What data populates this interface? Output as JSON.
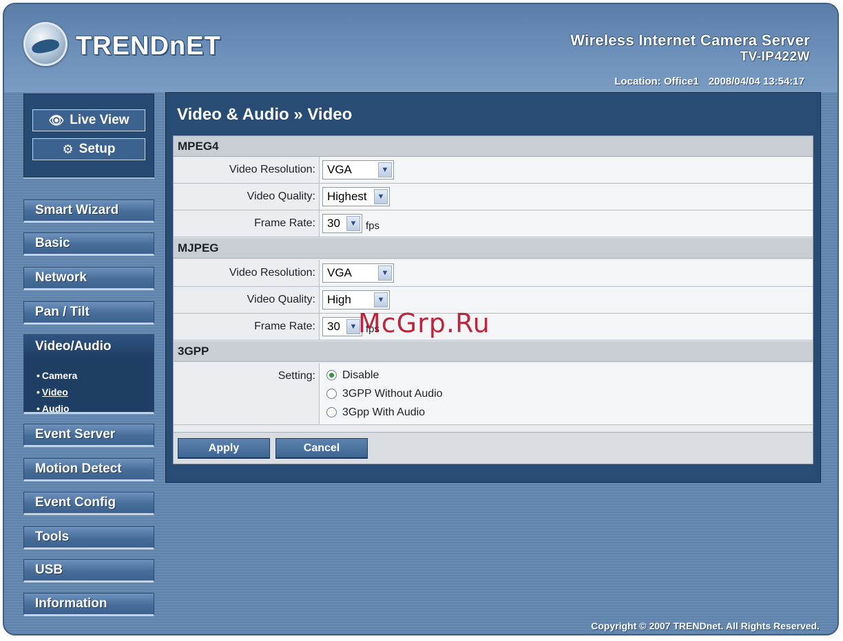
{
  "brand": {
    "logo_text": "TRENDnET"
  },
  "product": {
    "name": "Wireless Internet Camera Server",
    "model": "TV-IP422W"
  },
  "location": {
    "label": "Location: Office1",
    "datetime": "2008/04/04 13:54:17"
  },
  "view_buttons": {
    "live_view": "Live View",
    "setup": "Setup"
  },
  "menu": {
    "items": [
      "Smart Wizard",
      "Basic",
      "Network",
      "Pan / Tilt",
      "Video/Audio",
      "Event Server",
      "Motion Detect",
      "Event Config",
      "Tools",
      "USB",
      "Information"
    ],
    "active": "Video/Audio",
    "submenu": [
      "Camera",
      "Video",
      "Audio"
    ],
    "current_sub": "Video"
  },
  "panel": {
    "title": "Video & Audio » Video",
    "mpeg4": {
      "heading": "MPEG4",
      "resolution_label": "Video Resolution:",
      "resolution_value": "VGA",
      "quality_label": "Video Quality:",
      "quality_value": "Highest",
      "framerate_label": "Frame Rate:",
      "framerate_value": "30",
      "framerate_unit": "fps"
    },
    "mjpeg": {
      "heading": "MJPEG",
      "resolution_label": "Video Resolution:",
      "resolution_value": "VGA",
      "quality_label": "Video Quality:",
      "quality_value": "High",
      "framerate_label": "Frame Rate:",
      "framerate_value": "30",
      "framerate_unit": "fps"
    },
    "gpp": {
      "heading": "3GPP",
      "setting_label": "Setting:",
      "options": [
        "Disable",
        "3GPP Without Audio",
        "3Gpp With Audio"
      ],
      "selected": "Disable"
    },
    "apply": "Apply",
    "cancel": "Cancel"
  },
  "footer": {
    "copyright": "Copyright © 2007 TRENDnet. All Rights Reserved."
  },
  "watermark": "McGrp.Ru",
  "colors": {
    "panel_bg": "#284c74",
    "accent": "#3e6592",
    "radio_on": "#2c9a3c"
  }
}
